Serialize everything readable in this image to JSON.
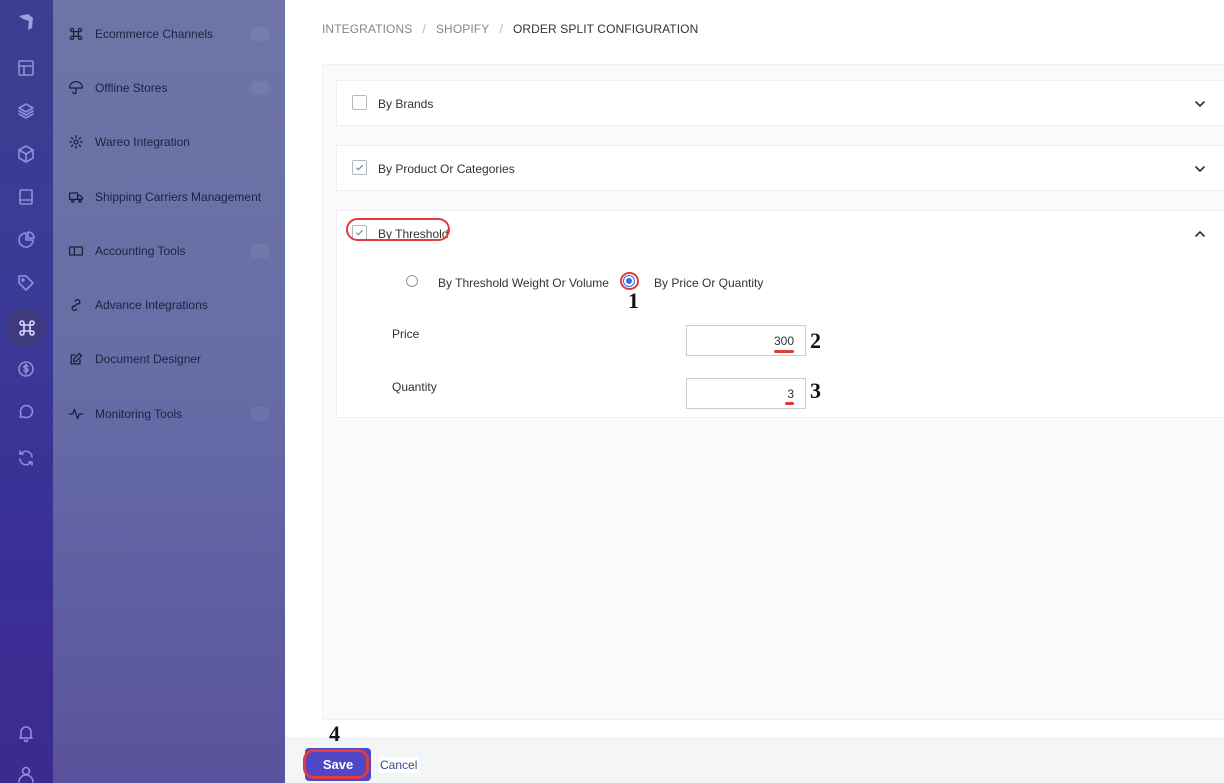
{
  "rail": {
    "icons": [
      "logo-icon",
      "layout-icon",
      "layers-icon",
      "box-icon",
      "book-icon",
      "pie-chart-icon",
      "tag-icon",
      "command-icon",
      "dollar-icon",
      "chat-icon",
      "sync-icon",
      "bell-icon",
      "user-icon"
    ],
    "active": "command-icon"
  },
  "sidebar": {
    "items": [
      {
        "label": "Ecommerce Channels",
        "icon": "command-icon"
      },
      {
        "label": "Offline Stores",
        "icon": "umbrella-icon"
      },
      {
        "label": "Wareo Integration",
        "icon": "gear-icon"
      },
      {
        "label": "Shipping Carriers Management",
        "icon": "truck-icon"
      },
      {
        "label": "Accounting Tools",
        "icon": "wallet-icon"
      },
      {
        "label": "Advance Integrations",
        "icon": "link-icon"
      },
      {
        "label": "Document Designer",
        "icon": "edit-icon"
      },
      {
        "label": "Monitoring Tools",
        "icon": "activity-icon"
      }
    ]
  },
  "breadcrumb": {
    "items": [
      "INTEGRATIONS",
      "SHOPIFY",
      "ORDER SPLIT CONFIGURATION"
    ],
    "separator": "/"
  },
  "sections": [
    {
      "title": "By Brands",
      "checked": false,
      "expanded": false
    },
    {
      "title": "By Product Or Categories",
      "checked": true,
      "expanded": false
    },
    {
      "title": "By Threshold",
      "checked": true,
      "expanded": true
    }
  ],
  "threshold": {
    "options": [
      {
        "label": "By Threshold Weight Or Volume",
        "selected": false
      },
      {
        "label": "By Price Or Quantity",
        "selected": true
      }
    ],
    "price_label": "Price",
    "price_value": "300",
    "quantity_label": "Quantity",
    "quantity_value": "3"
  },
  "steps": [
    "1",
    "2",
    "3",
    "4"
  ],
  "footer": {
    "save_label": "Save",
    "cancel_label": "Cancel"
  },
  "colors": {
    "accent": "#4f46c8",
    "annotation": "#e23b3b",
    "radio": "#2f6fe8"
  }
}
